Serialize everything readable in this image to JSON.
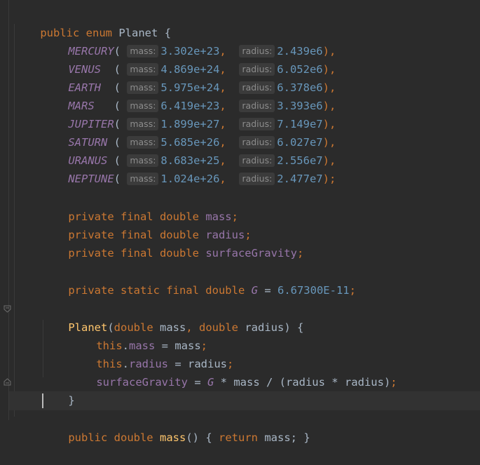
{
  "editor": {
    "enum_decl": {
      "modifier": "public",
      "keyword": "enum",
      "name": "Planet",
      "brace": "{"
    },
    "planets": [
      {
        "name": "MERCURY",
        "pad": "(",
        "mass_hint": "mass:",
        "mass": "3.302e+23",
        "radius_hint": "radius:",
        "radius": "2.439e6",
        "end": "),"
      },
      {
        "name": "VENUS",
        "pad": "  (",
        "mass_hint": "mass:",
        "mass": "4.869e+24",
        "radius_hint": "radius:",
        "radius": "6.052e6",
        "end": "),"
      },
      {
        "name": "EARTH",
        "pad": "  (",
        "mass_hint": "mass:",
        "mass": "5.975e+24",
        "radius_hint": "radius:",
        "radius": "6.378e6",
        "end": "),"
      },
      {
        "name": "MARS",
        "pad": "   (",
        "mass_hint": "mass:",
        "mass": "6.419e+23",
        "radius_hint": "radius:",
        "radius": "3.393e6",
        "end": "),"
      },
      {
        "name": "JUPITER",
        "pad": "(",
        "mass_hint": "mass:",
        "mass": "1.899e+27",
        "radius_hint": "radius:",
        "radius": "7.149e7",
        "end": "),"
      },
      {
        "name": "SATURN",
        "pad": " (",
        "mass_hint": "mass:",
        "mass": "5.685e+26",
        "radius_hint": "radius:",
        "radius": "6.027e7",
        "end": "),"
      },
      {
        "name": "URANUS",
        "pad": " (",
        "mass_hint": "mass:",
        "mass": "8.683e+25",
        "radius_hint": "radius:",
        "radius": "2.556e7",
        "end": "),"
      },
      {
        "name": "NEPTUNE",
        "pad": "(",
        "mass_hint": "mass:",
        "mass": "1.024e+26",
        "radius_hint": "radius:",
        "radius": "2.477e7",
        "end": ");"
      }
    ],
    "fields": [
      {
        "mods": "private final double",
        "name": "mass",
        "end": ";"
      },
      {
        "mods": "private final double",
        "name": "radius",
        "end": ";"
      },
      {
        "mods": "private final double",
        "name": "surfaceGravity",
        "end": ";"
      }
    ],
    "const_line": {
      "mods": "private static final double",
      "name": "G",
      "eq": " = ",
      "value": "6.67300E-11",
      "end": ";"
    },
    "constructor": {
      "name": "Planet",
      "open": "(",
      "p1_type": "double",
      "p1_name": " mass",
      "comma": ",",
      "p2_type": " double",
      "p2_name": " radius",
      "close": ") {"
    },
    "body": [
      {
        "this": "this",
        "dot": ".",
        "field": "mass",
        "rest": " = mass",
        "end": ";"
      },
      {
        "this": "this",
        "dot": ".",
        "field": "radius",
        "rest": " = radius",
        "end": ";"
      }
    ],
    "gravity_line": {
      "field": "surfaceGravity",
      "eq": " = ",
      "g": "G",
      "rest": " * mass / (radius * radius)",
      "end": ";"
    },
    "close_brace": "}",
    "partial_line": {
      "mods": "public double",
      "name": " mass",
      "rest": "() { ",
      "ret": "return",
      "tail": " mass; }"
    }
  }
}
